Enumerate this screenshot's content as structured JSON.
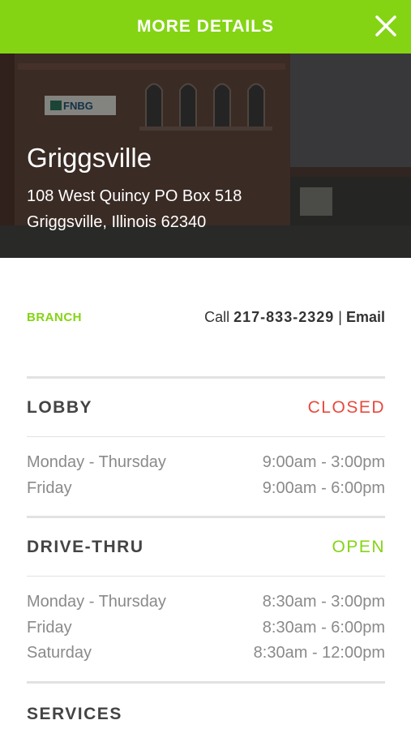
{
  "header": {
    "title": "MORE DETAILS",
    "close_icon": "close-icon"
  },
  "hero": {
    "city": "Griggsville",
    "address_line1": "108 West Quincy PO Box 518",
    "address_line2": "Griggsville, Illinois 62340",
    "sign_text": "FNBG"
  },
  "branch": {
    "label": "BRANCH",
    "call_label": "Call",
    "phone": "217-833-2329",
    "separator": "|",
    "email_label": "Email"
  },
  "lobby": {
    "title": "LOBBY",
    "status": "CLOSED",
    "hours": [
      {
        "days": "Monday - Thursday",
        "time": "9:00am - 3:00pm"
      },
      {
        "days": "Friday",
        "time": "9:00am - 6:00pm"
      }
    ]
  },
  "drive_thru": {
    "title": "DRIVE-THRU",
    "status": "OPEN",
    "hours": [
      {
        "days": "Monday - Thursday",
        "time": "8:30am - 3:00pm"
      },
      {
        "days": "Friday",
        "time": "8:30am - 6:00pm"
      },
      {
        "days": "Saturday",
        "time": "8:30am - 12:00pm"
      }
    ]
  },
  "services": {
    "title": "SERVICES"
  },
  "colors": {
    "accent": "#84d414",
    "closed": "#e84a3e",
    "open": "#84d414"
  }
}
